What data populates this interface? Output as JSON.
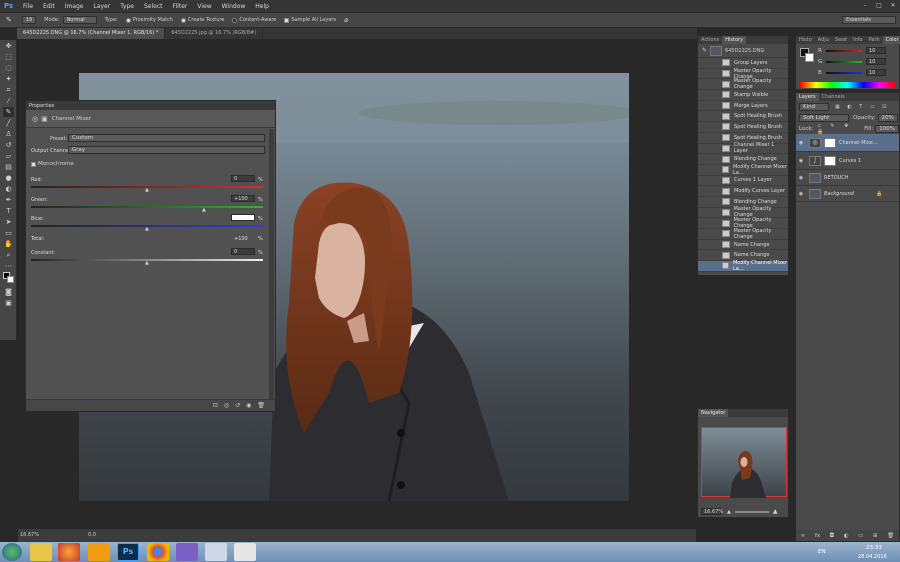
{
  "app": {
    "logo": "Ps",
    "menu": [
      "File",
      "Edit",
      "Image",
      "Layer",
      "Type",
      "Select",
      "Filter",
      "View",
      "Window",
      "Help"
    ],
    "window_controls": [
      "–",
      "□",
      "✕"
    ]
  },
  "options_bar": {
    "mode_label": "Mode:",
    "mode_value": "Normal",
    "type_label": "Type:",
    "proximity": "Proximity Match",
    "texture": "Create Texture",
    "content_aware": "Content-Aware",
    "sample_all": "Sample All Layers",
    "brush_size": "19",
    "workspace": "Essentials"
  },
  "doc_tabs": [
    "645D2225.DNG @ 16.7% (Channel Mixer 1, RGB/16) *",
    "645D2225.jpg @ 16.7% (RGB/8#)"
  ],
  "properties": {
    "title": "Properties",
    "adjustment": "Channel Mixer",
    "preset_label": "Preset:",
    "preset_value": "Custom",
    "output_label": "Output Channel:",
    "output_value": "Gray",
    "monochrome": "Monochrome",
    "red_label": "Red:",
    "red_value": "0",
    "red_pct": "%",
    "green_label": "Green:",
    "green_value": "+100",
    "green_pct": "%",
    "blue_label": "Blue:",
    "blue_value": "",
    "blue_pct": "%",
    "total_label": "Total:",
    "total_value": "+100",
    "total_pct": "%",
    "constant_label": "Constant:",
    "constant_value": "0",
    "constant_pct": "%"
  },
  "history": {
    "tabs": [
      "Actions",
      "History"
    ],
    "snapshot": "645D2225.DNG",
    "items": [
      "Group Layers",
      "Master Opacity Change",
      "Master Opacity Change",
      "Stamp Visible",
      "Merge Layers",
      "Spot Healing Brush",
      "Spot Healing Brush",
      "Spot Healing Brush",
      "Channel Mixer 1 Layer",
      "Blending Change",
      "Modify Channel Mixer La...",
      "Curves 1 Layer",
      "Modify Curves Layer",
      "Blending Change",
      "Master Opacity Change",
      "Master Opacity Change",
      "Master Opacity Change",
      "Name Change",
      "Name Change",
      "Modify Channel Mixer La..."
    ]
  },
  "color_panel": {
    "tabs": [
      "Histo",
      "Adju",
      "Swat",
      "Info",
      "Path",
      "Color"
    ],
    "r": "10",
    "g": "10",
    "b": "10",
    "r_label": "R",
    "g_label": "G",
    "b_label": "B"
  },
  "layers_panel": {
    "tabs": [
      "Layers",
      "Channels"
    ],
    "kind": "Kind",
    "blend_mode": "Soft Light",
    "opacity_label": "Opacity:",
    "opacity_value": "20%",
    "lock_label": "Lock:",
    "fill_label": "Fill:",
    "fill_value": "100%",
    "layers": [
      "Channel Mixe...",
      "Curves 1",
      "RETOUCH",
      "Background"
    ]
  },
  "navigator": {
    "title": "Navigator",
    "zoom": "16.67%"
  },
  "status": {
    "zoom": "16.67%",
    "doc": "0.0"
  },
  "taskbar": {
    "lang": "EN",
    "time": "23:33",
    "date": "28.04.2016"
  }
}
